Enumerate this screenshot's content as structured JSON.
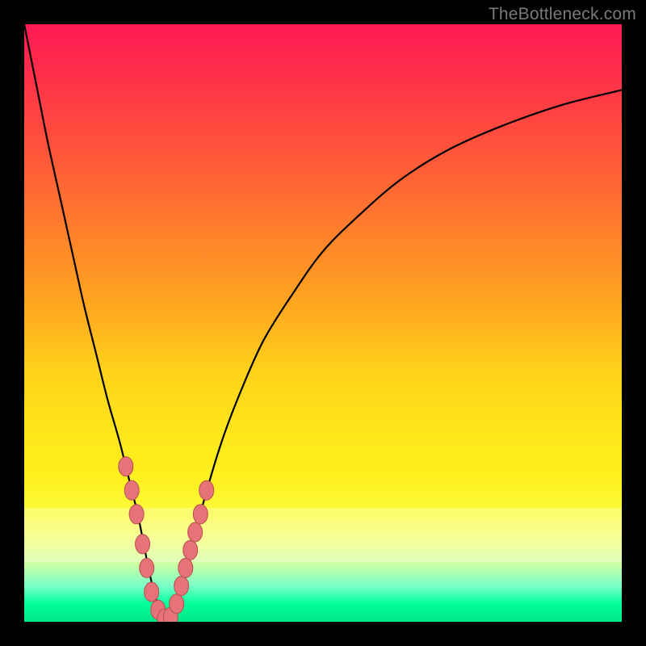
{
  "watermark": {
    "text": "TheBottleneck.com"
  },
  "colors": {
    "curve_stroke": "#000000",
    "marker_fill": "#e57377",
    "marker_stroke": "#b84e52"
  },
  "chart_data": {
    "type": "line",
    "title": "",
    "xlabel": "",
    "ylabel": "",
    "xlim": [
      0,
      100
    ],
    "ylim": [
      0,
      100
    ],
    "series": [
      {
        "name": "bottleneck-curve",
        "x": [
          0,
          2,
          4,
          6,
          8,
          10,
          12,
          14,
          16,
          18,
          19,
          20,
          21,
          22,
          23,
          24,
          25,
          26,
          28,
          30,
          33,
          36,
          40,
          45,
          50,
          56,
          63,
          71,
          80,
          90,
          100
        ],
        "y": [
          100,
          90,
          80,
          71,
          62,
          53,
          45,
          37,
          30,
          22,
          18,
          13,
          8,
          4,
          1,
          0,
          1,
          5,
          12,
          20,
          30,
          38,
          47,
          55,
          62,
          68,
          74,
          79,
          83,
          86.5,
          89
        ]
      }
    ],
    "markers": [
      {
        "x": 17.0,
        "y": 26
      },
      {
        "x": 18.0,
        "y": 22
      },
      {
        "x": 18.8,
        "y": 18
      },
      {
        "x": 19.8,
        "y": 13
      },
      {
        "x": 20.5,
        "y": 9
      },
      {
        "x": 21.3,
        "y": 5
      },
      {
        "x": 22.4,
        "y": 2
      },
      {
        "x": 23.5,
        "y": 0.5
      },
      {
        "x": 24.5,
        "y": 0.8
      },
      {
        "x": 25.5,
        "y": 3
      },
      {
        "x": 26.3,
        "y": 6
      },
      {
        "x": 27.0,
        "y": 9
      },
      {
        "x": 27.8,
        "y": 12
      },
      {
        "x": 28.6,
        "y": 15
      },
      {
        "x": 29.5,
        "y": 18
      },
      {
        "x": 30.5,
        "y": 22
      }
    ]
  }
}
